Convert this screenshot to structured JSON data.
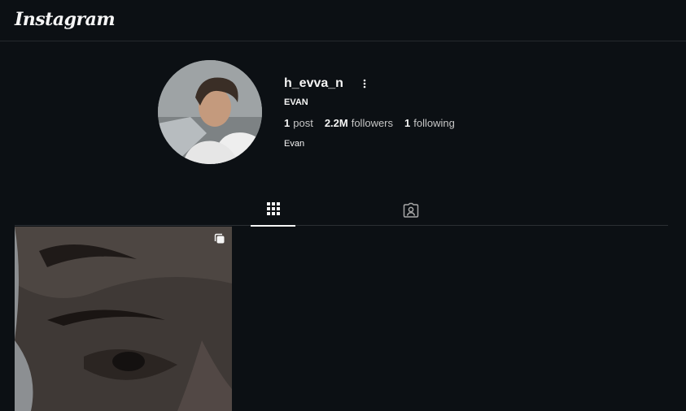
{
  "header": {
    "logo_text": "Instagram"
  },
  "profile": {
    "username": "h_evva_n",
    "full_name": "EVAN",
    "stats": {
      "posts_count": "1",
      "posts_label": "post",
      "followers_count": "2.2M",
      "followers_label": "followers",
      "following_count": "1",
      "following_label": "following"
    },
    "bio": "Evan",
    "more_icon": "more-vertical-icon"
  },
  "tabs": [
    {
      "name": "posts",
      "icon": "grid-icon",
      "active": true
    },
    {
      "name": "tagged",
      "icon": "tagged-user-icon",
      "active": false
    }
  ],
  "posts": [
    {
      "type": "carousel",
      "badge_icon": "carousel-icon"
    }
  ],
  "colors": {
    "background": "#0c1014",
    "text": "#f5f5f5",
    "muted_text": "#c7c7c7",
    "divider": "#262a2e"
  }
}
